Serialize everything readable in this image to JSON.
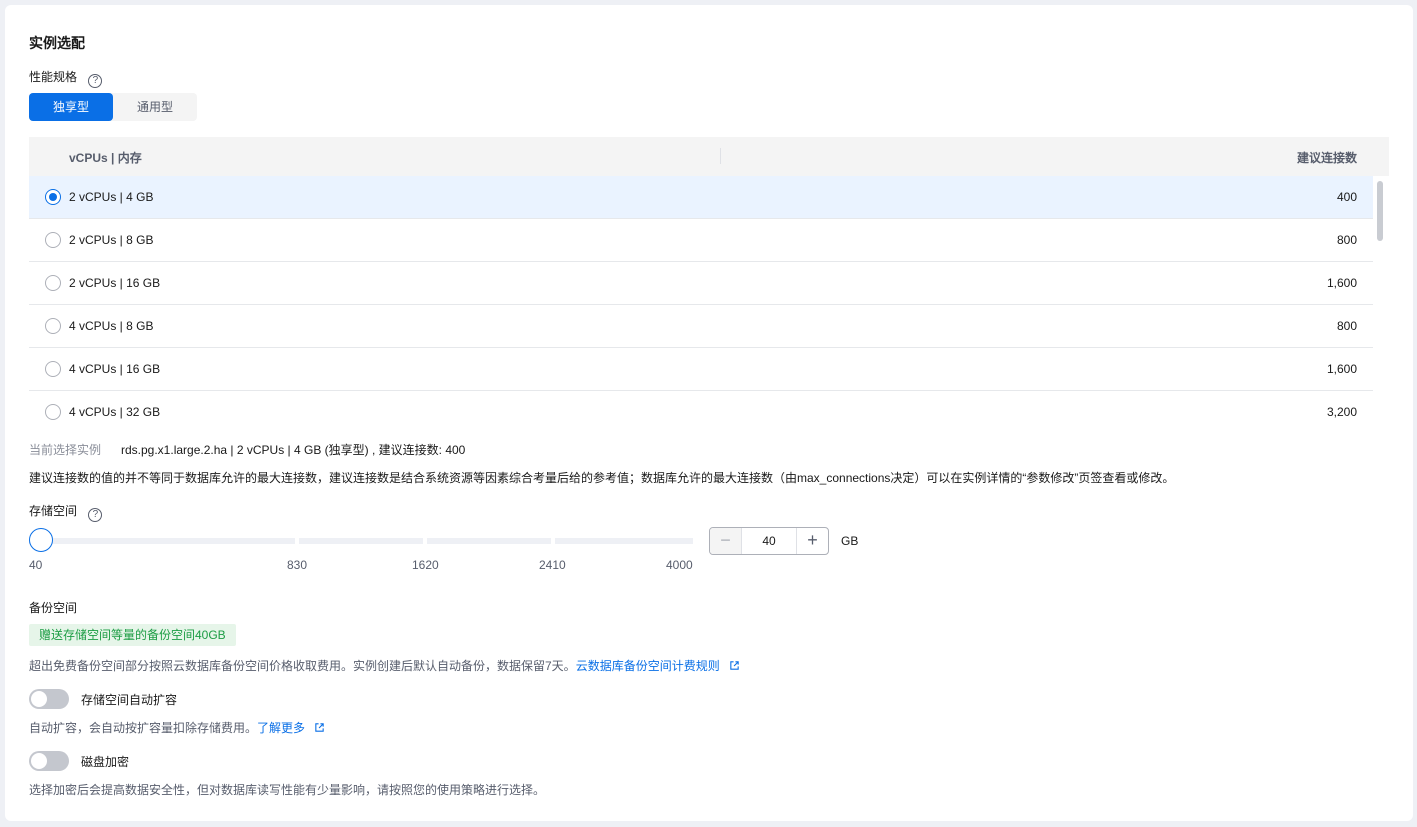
{
  "section": {
    "title": "实例选配"
  },
  "perf": {
    "label": "性能规格",
    "help_icon": "?",
    "tabs": [
      {
        "label": "独享型",
        "active": true
      },
      {
        "label": "通用型",
        "active": false
      }
    ]
  },
  "table": {
    "headers": {
      "spec": "vCPUs | 内存",
      "connections": "建议连接数"
    },
    "rows": [
      {
        "spec": "2 vCPUs | 4 GB",
        "connections": "400",
        "selected": true
      },
      {
        "spec": "2 vCPUs | 8 GB",
        "connections": "800",
        "selected": false
      },
      {
        "spec": "2 vCPUs | 16 GB",
        "connections": "1,600",
        "selected": false
      },
      {
        "spec": "4 vCPUs | 8 GB",
        "connections": "800",
        "selected": false
      },
      {
        "spec": "4 vCPUs | 16 GB",
        "connections": "1,600",
        "selected": false
      },
      {
        "spec": "4 vCPUs | 32 GB",
        "connections": "3,200",
        "selected": false
      }
    ]
  },
  "current": {
    "label": "当前选择实例",
    "value": "rds.pg.x1.large.2.ha | 2 vCPUs | 4 GB (独享型) , 建议连接数: 400"
  },
  "note": "建议连接数的值的并不等同于数据库允许的最大连接数，建议连接数是结合系统资源等因素综合考量后给的参考值；数据库允许的最大连接数（由max_connections决定）可以在实例详情的“参数修改”页签查看或修改。",
  "storage": {
    "label": "存储空间",
    "help_icon": "?",
    "ticks": [
      "40",
      "830",
      "1620",
      "2410",
      "4000"
    ],
    "value": "40",
    "unit": "GB",
    "minus": "−",
    "plus": "+"
  },
  "backup": {
    "label": "备份空间",
    "badge": "赠送存储空间等量的备份空间40GB",
    "desc": "超出免费备份空间部分按照云数据库备份空间价格收取费用。实例创建后默认自动备份，数据保留7天。",
    "link": "云数据库备份空间计费规则"
  },
  "autoscale": {
    "label": "存储空间自动扩容",
    "enabled": false,
    "desc": "自动扩容，会自动按扩容量扣除存储费用。",
    "link": "了解更多"
  },
  "encrypt": {
    "label": "磁盘加密",
    "enabled": false,
    "desc": "选择加密后会提高数据安全性，但对数据库读写性能有少量影响，请按照您的使用策略进行选择。"
  },
  "colors": {
    "primary": "#0a6fe6",
    "success": "#1c9d44"
  },
  "icons": [
    "help-icon",
    "radio-icon",
    "minus-icon",
    "plus-icon",
    "external-link-icon"
  ]
}
